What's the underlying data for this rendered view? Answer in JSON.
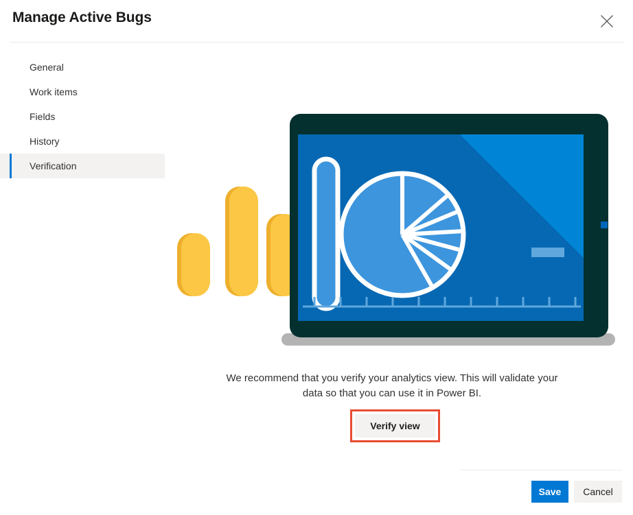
{
  "header": {
    "title": "Manage Active Bugs",
    "close_icon": "close-icon"
  },
  "sidebar": {
    "items": [
      {
        "label": "General",
        "selected": false
      },
      {
        "label": "Work items",
        "selected": false
      },
      {
        "label": "Fields",
        "selected": false
      },
      {
        "label": "History",
        "selected": false
      },
      {
        "label": "Verification",
        "selected": true
      }
    ]
  },
  "main": {
    "illustration_name": "analytics-tablet-illustration",
    "recommend_text": "We recommend that you verify your analytics view. This will validate your data so that you can use it in Power BI.",
    "verify_button_label": "Verify view"
  },
  "footer": {
    "save_label": "Save",
    "cancel_label": "Cancel"
  },
  "colors": {
    "accent": "#0078d4",
    "highlight_border": "#e74c32",
    "button_neutral": "#f3f2f1",
    "selected_row": "#f3f2f1",
    "text_primary": "#323130",
    "divider": "#edebe9",
    "bar_yellow": "#fbc744",
    "bar_yellow_shade": "#edaf2c",
    "device_bezel": "#04302f",
    "screen_blue": "#0668b3",
    "screen_blue_light": "#0085d6",
    "pie_fill": "#3d95dd",
    "stand_gray": "#b3b3b3"
  }
}
